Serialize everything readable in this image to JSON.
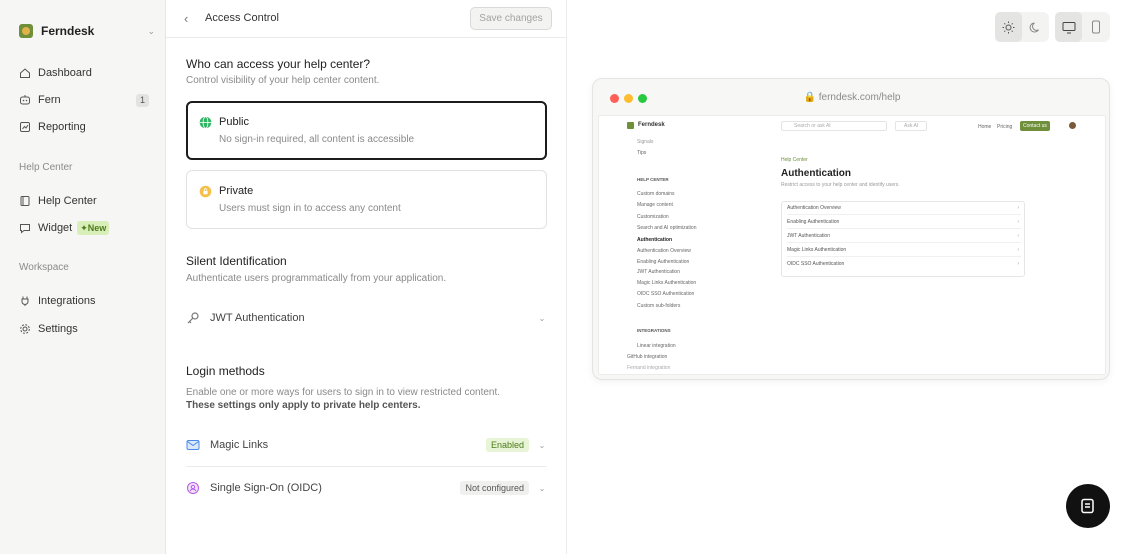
{
  "sidebar": {
    "brand": "Ferndesk",
    "items": [
      {
        "label": "Dashboard"
      },
      {
        "label": "Fern",
        "count": "1"
      },
      {
        "label": "Reporting"
      },
      {
        "label": "Help Center"
      },
      {
        "label": "Widget",
        "badge": "New"
      },
      {
        "label": "Integrations"
      },
      {
        "label": "Settings"
      }
    ],
    "sections": [
      "Help Center",
      "Workspace"
    ]
  },
  "header": {
    "title": "Access Control",
    "save_label": "Save changes"
  },
  "access": {
    "heading": "Who can access your help center?",
    "subheading": "Control visibility of your help center content.",
    "options": [
      {
        "title": "Public",
        "desc": "No sign-in required, all content is accessible",
        "selected": true
      },
      {
        "title": "Private",
        "desc": "Users must sign in to access any content",
        "selected": false
      }
    ]
  },
  "silent": {
    "heading": "Silent Identification",
    "subheading": "Authenticate users programmatically from your application.",
    "jwt_label": "JWT Authentication"
  },
  "login": {
    "heading": "Login methods",
    "desc": "Enable one or more ways for users to sign in to view restricted content. ",
    "desc_bold": "These settings only apply to private help centers.",
    "methods": [
      {
        "label": "Magic Links",
        "status": "Enabled"
      },
      {
        "label": "Single Sign-On (OIDC)",
        "status": "Not configured"
      }
    ]
  },
  "preview": {
    "url": "ferndesk.com/help",
    "site_name": "Ferndesk",
    "search_placeholder": "Search or ask AI",
    "ask_ai": "Ask AI",
    "nav": [
      "Home",
      "Pricing",
      "Contact us"
    ],
    "sidebar_top": [
      "Signals",
      "Tips"
    ],
    "section_help": "HELP CENTER",
    "help_items": [
      "Custom domains",
      "Manage content",
      "Customization",
      "Search and AI optimization",
      "Authentication"
    ],
    "auth_sub": [
      "Authentication Overview",
      "Enabling Authentication",
      "JWT Authentication",
      "Magic Links Authentication",
      "OIDC SSO Authentication"
    ],
    "custom_subfolders": "Custom sub-folders",
    "section_integrations": "INTEGRATIONS",
    "integration_items": [
      "Linear integration",
      "GitHub integration",
      "Fernand integration"
    ],
    "breadcrumb": "Help Center",
    "article_title": "Authentication",
    "article_desc": "Restrict access to your help center and identify users.",
    "article_links": [
      "Authentication Overview",
      "Enabling Authentication",
      "JWT Authentication",
      "Magic Links Authentication",
      "OIDC SSO Authentication"
    ]
  },
  "colors": {
    "accent": "#6f8f3b",
    "mac_red": "#ff5f57",
    "mac_yellow": "#febc2e",
    "mac_green": "#28c840"
  }
}
